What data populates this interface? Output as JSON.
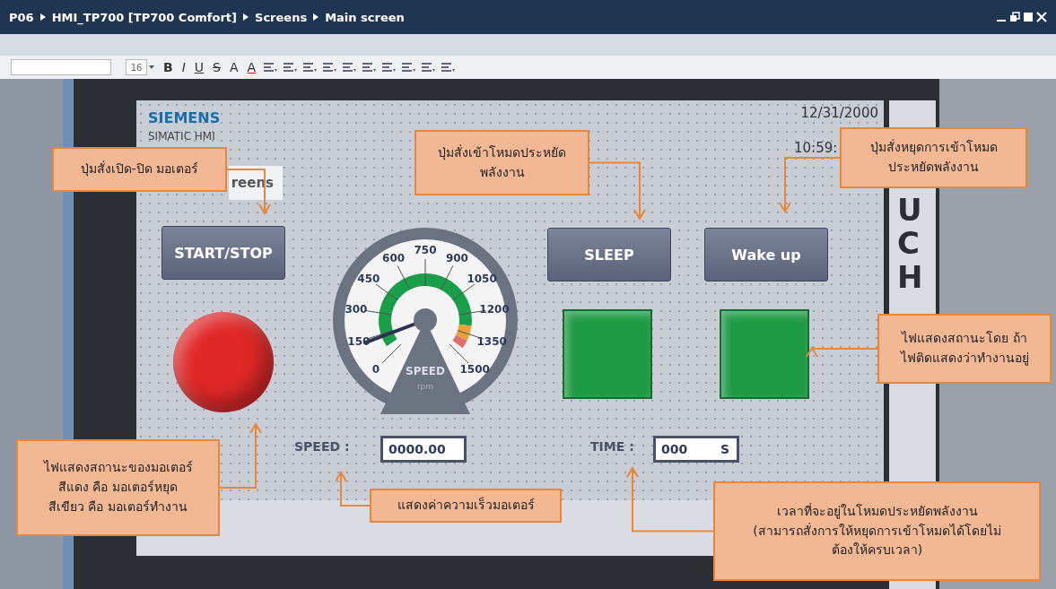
{
  "breadcrumb": [
    "P06",
    "HMI_TP700 [TP700 Comfort]",
    "Screens",
    "Main screen"
  ],
  "toolbar": {
    "font_size": "16",
    "glyphs": [
      {
        "text": "B",
        "kind": "bold"
      },
      {
        "text": "I",
        "kind": "italic"
      },
      {
        "text": "U",
        "kind": "underline"
      },
      {
        "text": "S",
        "kind": "strike"
      },
      {
        "text": "A",
        "kind": "plain"
      },
      {
        "text": "A",
        "kind": "color"
      }
    ]
  },
  "hmi": {
    "brand": "SIEMENS",
    "model": "SIMATIC HMI",
    "tab": "reens",
    "date": "12/31/2000",
    "time": "10:59:",
    "bezel_text": "UCH",
    "buttons": [
      {
        "label": "START/STOP"
      },
      {
        "label": "SLEEP"
      },
      {
        "label": "Wake up"
      }
    ],
    "lamps": [
      {
        "kind": "round",
        "color": "#e02828"
      },
      {
        "kind": "square",
        "color": "#1f9a45"
      },
      {
        "kind": "square",
        "color": "#1f9a45"
      }
    ],
    "gauge": {
      "ticks": [
        "0",
        "150",
        "300",
        "450",
        "600",
        "750",
        "900",
        "1050",
        "1200",
        "1350",
        "1500"
      ],
      "label": "SPEED",
      "unit": "rpm"
    },
    "fields": [
      {
        "label": "SPEED :",
        "value": "0000.00"
      },
      {
        "label": "TIME :",
        "value": "000",
        "unit": "S"
      }
    ]
  },
  "callouts": [
    {
      "text": "ปุ่มสั่งเปิด-ปิด มอเตอร์"
    },
    {
      "text": "ปุ่มสั่งเข้าโหมดประหยัด\nพลังงาน"
    },
    {
      "text": "ปุ่มสั่งหยุดการเข้าโหมด\nประหยัดพลังงาน"
    },
    {
      "text": "ไฟแสดงสถานะโดย ถ้า\nไฟติดแสดงว่าทำงานอยู่"
    },
    {
      "text": "ไฟแสดงสถานะของมอเตอร์\nสีแดง คือ มอเตอร์หยุด\nสีเขียว คือ มอเตอร์ทำงาน"
    },
    {
      "text": "แสดงค่าความเร็วมอเตอร์"
    },
    {
      "text": "เวลาที่จะอยู่ในโหมดประหยัดพลังงาน\n(สามารถสั่งการให้หยุดการเข้าโหมดได้โดยไม่\nต้องให้ครบเวลา)"
    }
  ]
}
